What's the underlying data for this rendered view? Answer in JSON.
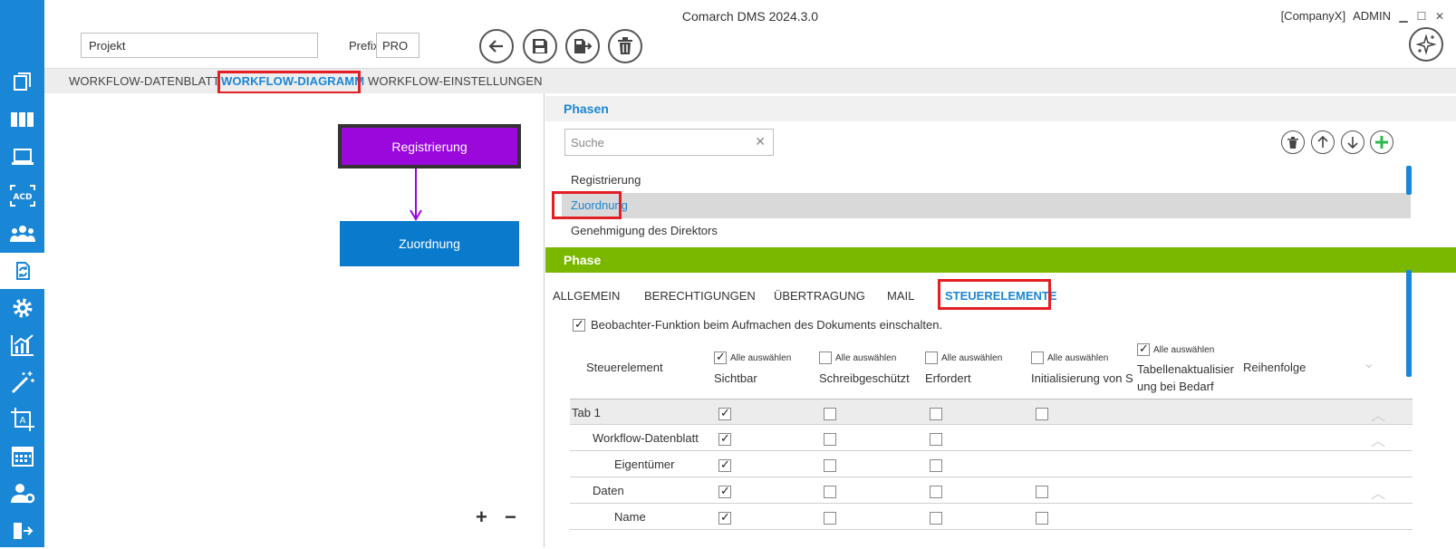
{
  "app": {
    "title": "Comarch DMS 2024.3.0",
    "company": "[CompanyX]",
    "user": "ADMIN"
  },
  "header": {
    "project_value": "Projekt",
    "prefix_label": "Prefix:",
    "prefix_value": "PRO"
  },
  "tabs": [
    {
      "label": "WORKFLOW-DATENBLATT",
      "active": false
    },
    {
      "label": "WORKFLOW-DIAGRAMM",
      "active": true
    },
    {
      "label": "WORKFLOW-EINSTELLUNGEN",
      "active": false
    }
  ],
  "diagram": {
    "nodes": [
      "Registrierung",
      "Zuordnung"
    ],
    "zoom_in": "+",
    "zoom_out": "−"
  },
  "phasen": {
    "title": "Phasen",
    "search_placeholder": "Suche",
    "items": [
      "Registrierung",
      "Zuordnung",
      "Genehmigung des Direktors"
    ],
    "selected": "Zuordnung"
  },
  "phase": {
    "title": "Phase",
    "subtabs": [
      "ALLGEMEIN",
      "BERECHTIGUNGEN",
      "ÜBERTRAGUNG",
      "MAIL",
      "STEUERELEMENTE"
    ],
    "observer_label": "Beobachter-Funktion beim Aufmachen des Dokuments einschalten.",
    "observer_checked": true
  },
  "grid": {
    "select_all": "Alle auswählen",
    "col_control": "Steuerelement",
    "col_visible": "Sichtbar",
    "col_readonly": "Schreibgeschützt",
    "col_required": "Erfordert",
    "col_init": "Initialisierung von S",
    "col_table_1": "Tabellenaktualisier",
    "col_table_2": "ung bei Bedarf",
    "col_order": "Reihenfolge",
    "rows": [
      {
        "label": "Tab 1"
      },
      {
        "label": "Workflow-Datenblatt"
      },
      {
        "label": "Eigentümer"
      },
      {
        "label": "Daten"
      },
      {
        "label": "Name"
      }
    ]
  }
}
